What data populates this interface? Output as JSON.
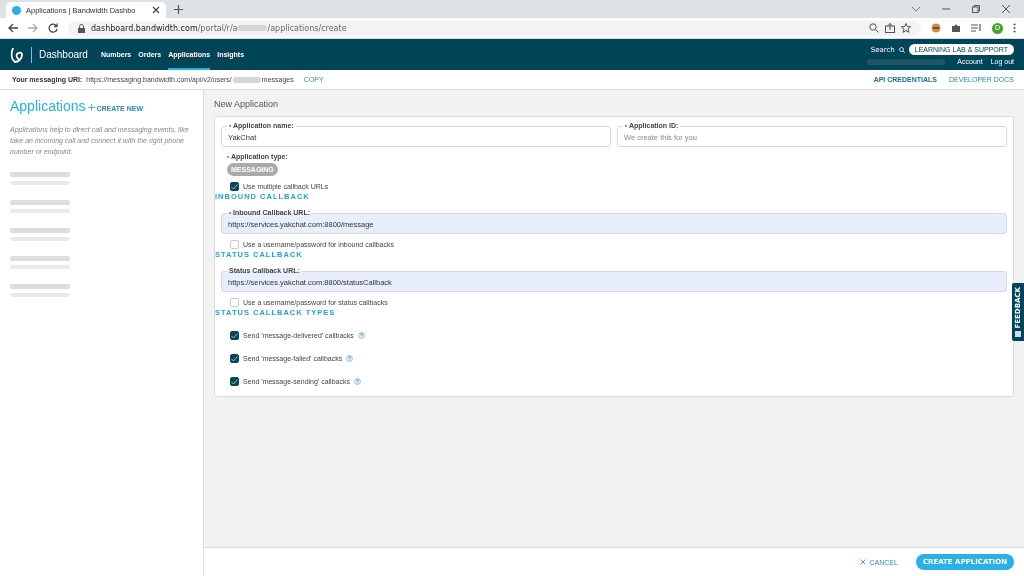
{
  "browser": {
    "tab_title": "Applications | Bandwidth Dashbo",
    "url_host": "dashboard.bandwidth.com",
    "url_path_start": "/portal/r/a",
    "url_path_end": "/applications/create",
    "profile_initial": "D"
  },
  "nav": {
    "brand": "Dashboard",
    "items": [
      {
        "label": "Numbers",
        "selected": false
      },
      {
        "label": "Orders",
        "selected": false
      },
      {
        "label": "Applications",
        "selected": true
      },
      {
        "label": "Insights",
        "selected": false
      }
    ],
    "search": "Search",
    "support_button": "LEARNING LAB & SUPPORT",
    "account": "Account",
    "logout": "Log out"
  },
  "subbar": {
    "uri_label": "Your messaging URI:",
    "uri_start": "https://messaging.bandwidth.com/api/v2/users/",
    "uri_end": "messages",
    "copy": "COPY",
    "links": [
      "API CREDENTIALS",
      "DEVELOPER DOCS"
    ]
  },
  "sidebar": {
    "title": "Applications",
    "create": "CREATE NEW",
    "description": "Applications help to direct call and messaging events, like take an incoming call and connect it with the right phone number or endpoint."
  },
  "form": {
    "heading": "New Application",
    "name_field": {
      "label": "Application name:",
      "value": "YakChat",
      "required": true
    },
    "id_field": {
      "label": "Application ID:",
      "placeholder": "We create this for you",
      "required": true
    },
    "type": {
      "label": "Application type:",
      "value": "MESSAGING",
      "required": true
    },
    "multiple": {
      "label": "Use multiple callback URLs",
      "checked": true
    },
    "sections": [
      {
        "title": "INBOUND CALLBACK",
        "url_label": "Inbound Callback URL:",
        "url_value": "https://services.yakchat.com:8800/message",
        "required": true,
        "auth_label": "Use a username/password for inbound callbacks",
        "auth_checked": false
      },
      {
        "title": "STATUS CALLBACK",
        "url_label": "Status Callback URL:",
        "url_value": "https://services.yakchat.com:8800/statusCallback",
        "required": false,
        "auth_label": "Use a username/password for status callbacks",
        "auth_checked": false
      }
    ],
    "types_title": "STATUS CALLBACK TYPES",
    "types": [
      {
        "label": "Send 'message-delivered' callbacks",
        "checked": true
      },
      {
        "label": "Send 'message-failed' callbacks",
        "checked": true
      },
      {
        "label": "Send 'message-sending' callbacks",
        "checked": true
      }
    ]
  },
  "footer": {
    "cancel": "CANCEL",
    "create": "CREATE APPLICATION"
  },
  "feedback": "FEEDBACK"
}
